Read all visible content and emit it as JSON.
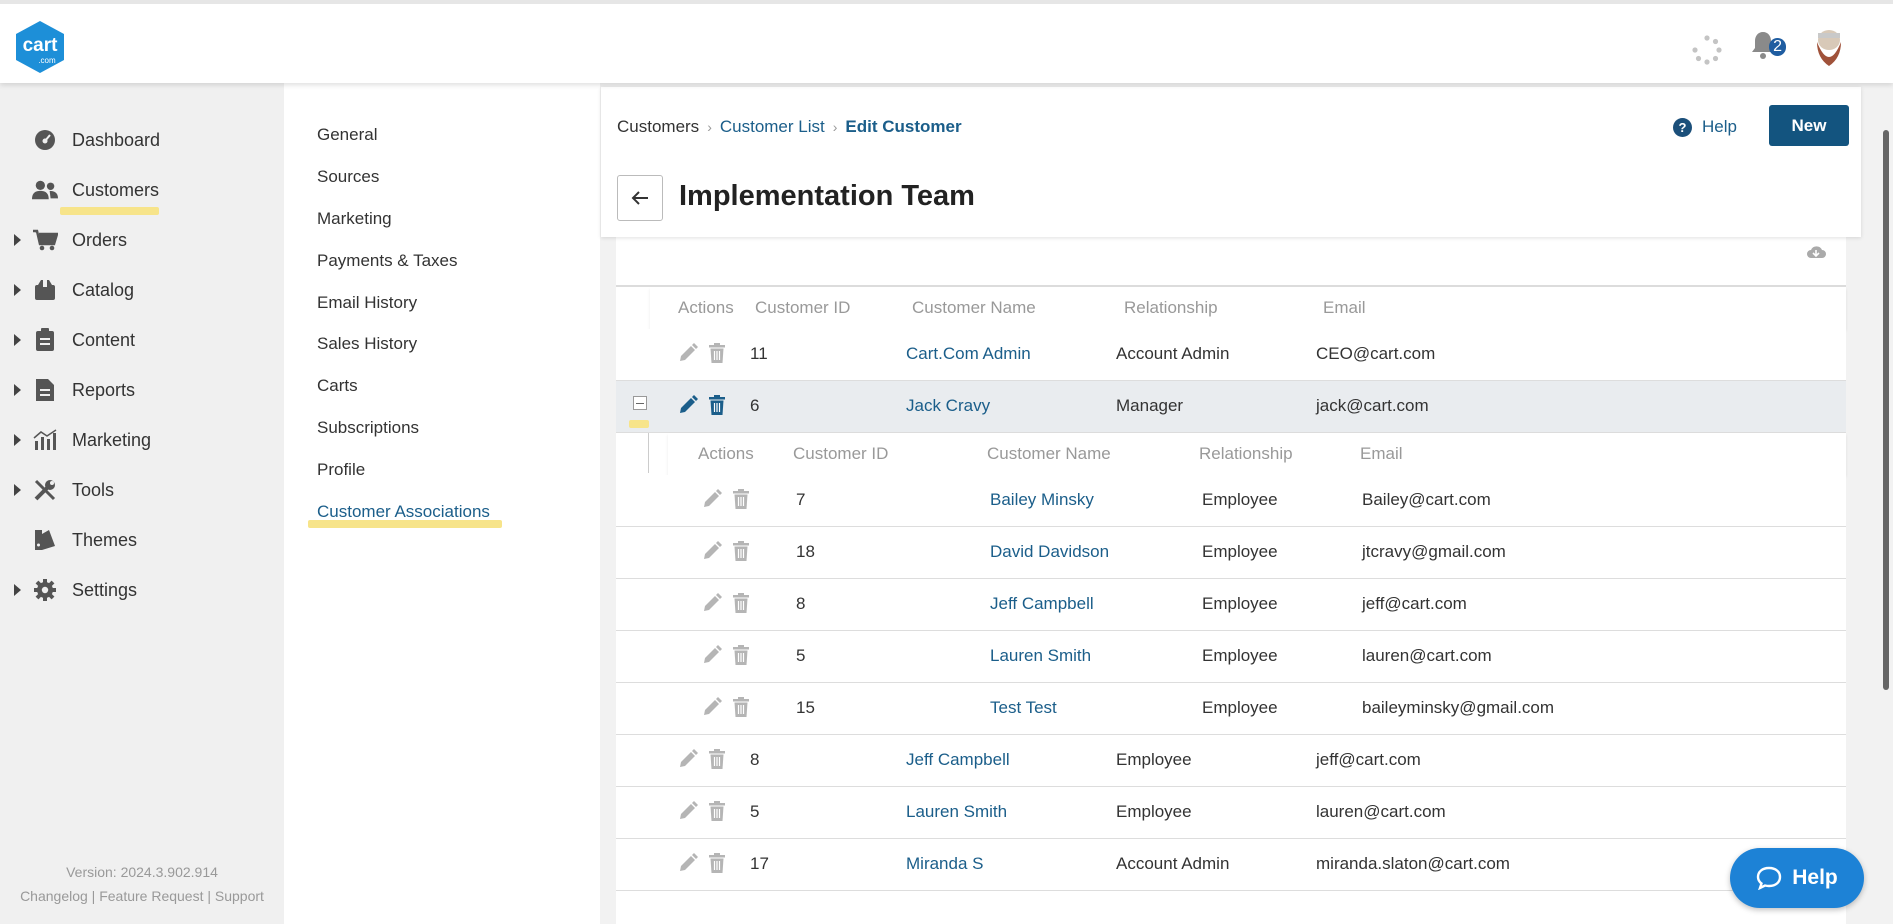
{
  "app": {
    "logo_text": "cart",
    "logo_sub": ".com",
    "notification_count": "2"
  },
  "sidebar": {
    "items": [
      {
        "label": "Dashboard",
        "icon": "dashboard-icon",
        "expandable": false
      },
      {
        "label": "Customers",
        "icon": "users-icon",
        "expandable": false,
        "active": true
      },
      {
        "label": "Orders",
        "icon": "cart-icon",
        "expandable": true
      },
      {
        "label": "Catalog",
        "icon": "box-icon",
        "expandable": true
      },
      {
        "label": "Content",
        "icon": "clipboard-icon",
        "expandable": true
      },
      {
        "label": "Reports",
        "icon": "document-icon",
        "expandable": true
      },
      {
        "label": "Marketing",
        "icon": "bar-chart-icon",
        "expandable": true
      },
      {
        "label": "Tools",
        "icon": "tools-icon",
        "expandable": true
      },
      {
        "label": "Themes",
        "icon": "themes-icon",
        "expandable": false
      },
      {
        "label": "Settings",
        "icon": "gear-icon",
        "expandable": true
      }
    ],
    "version": "Version: 2024.3.902.914",
    "footer_links": "Changelog | Feature Request | Support"
  },
  "subnav": {
    "items": [
      "General",
      "Sources",
      "Marketing",
      "Payments & Taxes",
      "Email History",
      "Sales History",
      "Carts",
      "Subscriptions",
      "Profile",
      "Customer Associations"
    ],
    "active": "Customer Associations"
  },
  "breadcrumb": {
    "items": [
      "Customers",
      "Customer List",
      "Edit Customer"
    ]
  },
  "header": {
    "help_label": "Help",
    "new_label": "New",
    "title": "Implementation Team"
  },
  "columns": {
    "actions": "Actions",
    "id": "Customer ID",
    "name": "Customer Name",
    "relationship": "Relationship",
    "email": "Email"
  },
  "rows": [
    {
      "id": "11",
      "name": "Cart.Com Admin",
      "relationship": "Account Admin",
      "email": "CEO@cart.com"
    },
    {
      "id": "6",
      "name": "Jack Cravy",
      "relationship": "Manager",
      "email": "jack@cart.com"
    },
    {
      "id": "8",
      "name": "Jeff Campbell",
      "relationship": "Employee",
      "email": "jeff@cart.com"
    },
    {
      "id": "5",
      "name": "Lauren Smith",
      "relationship": "Employee",
      "email": "lauren@cart.com"
    },
    {
      "id": "17",
      "name": "Miranda S",
      "relationship": "Account Admin",
      "email": "miranda.slaton@cart.com"
    }
  ],
  "sub_rows": [
    {
      "id": "7",
      "name": "Bailey Minsky",
      "relationship": "Employee",
      "email": "Bailey@cart.com"
    },
    {
      "id": "18",
      "name": "David Davidson",
      "relationship": "Employee",
      "email": "jtcravy@gmail.com"
    },
    {
      "id": "8",
      "name": "Jeff Campbell",
      "relationship": "Employee",
      "email": "jeff@cart.com"
    },
    {
      "id": "5",
      "name": "Lauren Smith",
      "relationship": "Employee",
      "email": "lauren@cart.com"
    },
    {
      "id": "15",
      "name": "Test Test",
      "relationship": "Employee",
      "email": "baileyminsky@gmail.com"
    }
  ],
  "help_fab": "Help",
  "colors": {
    "primary": "#13547f",
    "link": "#1b5e8a",
    "highlight": "#f7e48a",
    "fab": "#1d82d6"
  }
}
